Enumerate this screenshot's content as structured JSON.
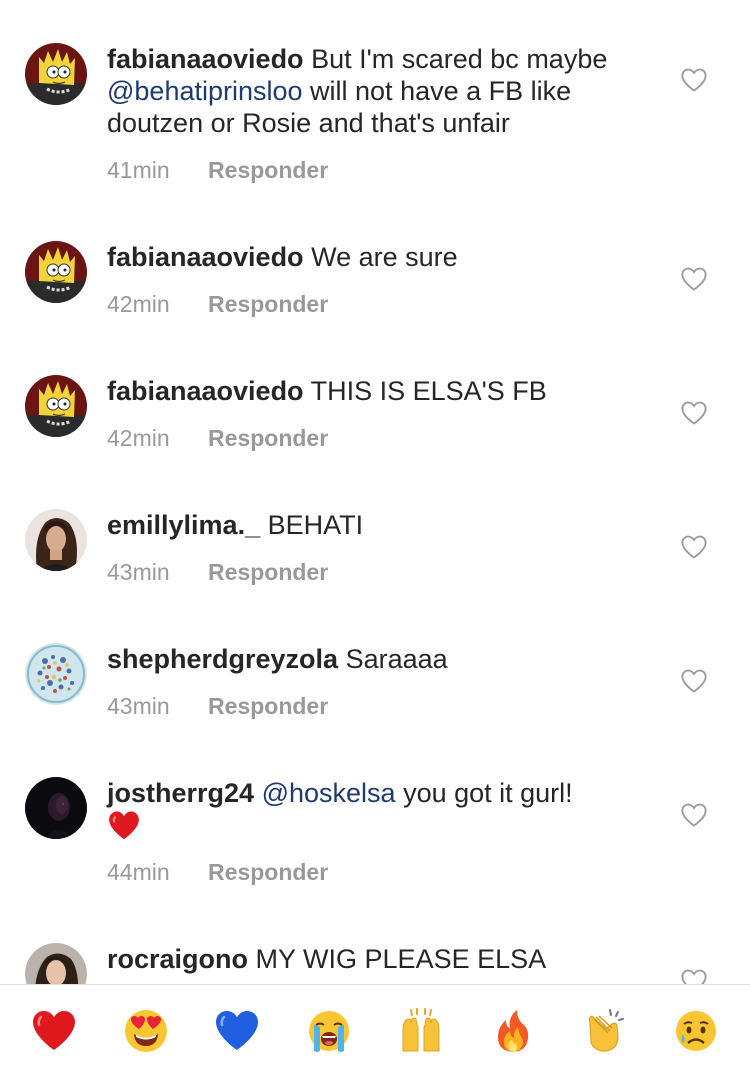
{
  "comments": [
    {
      "username": "fabianaaoviedo",
      "text_parts": [
        "But I'm scared bc maybe ",
        "@behatiprinsloo",
        " will not have a FB like doutzen or Rosie and that's unfair"
      ],
      "time": "41min",
      "reply": "Responder"
    },
    {
      "username": "fabianaaoviedo",
      "text": "We are sure",
      "time": "42min",
      "reply": "Responder"
    },
    {
      "username": "fabianaaoviedo",
      "text": "THIS IS ELSA'S FB",
      "time": "42min",
      "reply": "Responder"
    },
    {
      "username": "emillylima._",
      "text": "BEHATI",
      "time": "43min",
      "reply": "Responder"
    },
    {
      "username": "shepherdgreyzola",
      "text": "Saraaaa",
      "time": "43min",
      "reply": "Responder"
    },
    {
      "username": "jostherrg24",
      "mention": "@hoskelsa",
      "text": " you got it gurl!",
      "time": "44min",
      "reply": "Responder"
    },
    {
      "username": "rocraigono",
      "text": "MY WIG PLEASE ELSA"
    }
  ],
  "emoji_bar": [
    "red-heart",
    "heart-eyes",
    "blue-heart",
    "loudly-crying",
    "raised-hands",
    "fire",
    "clapping-hands",
    "crying-face"
  ],
  "colors": {
    "mention": "#1e3a6e",
    "meta": "#999999",
    "like_outline": "#9a9a9a"
  }
}
